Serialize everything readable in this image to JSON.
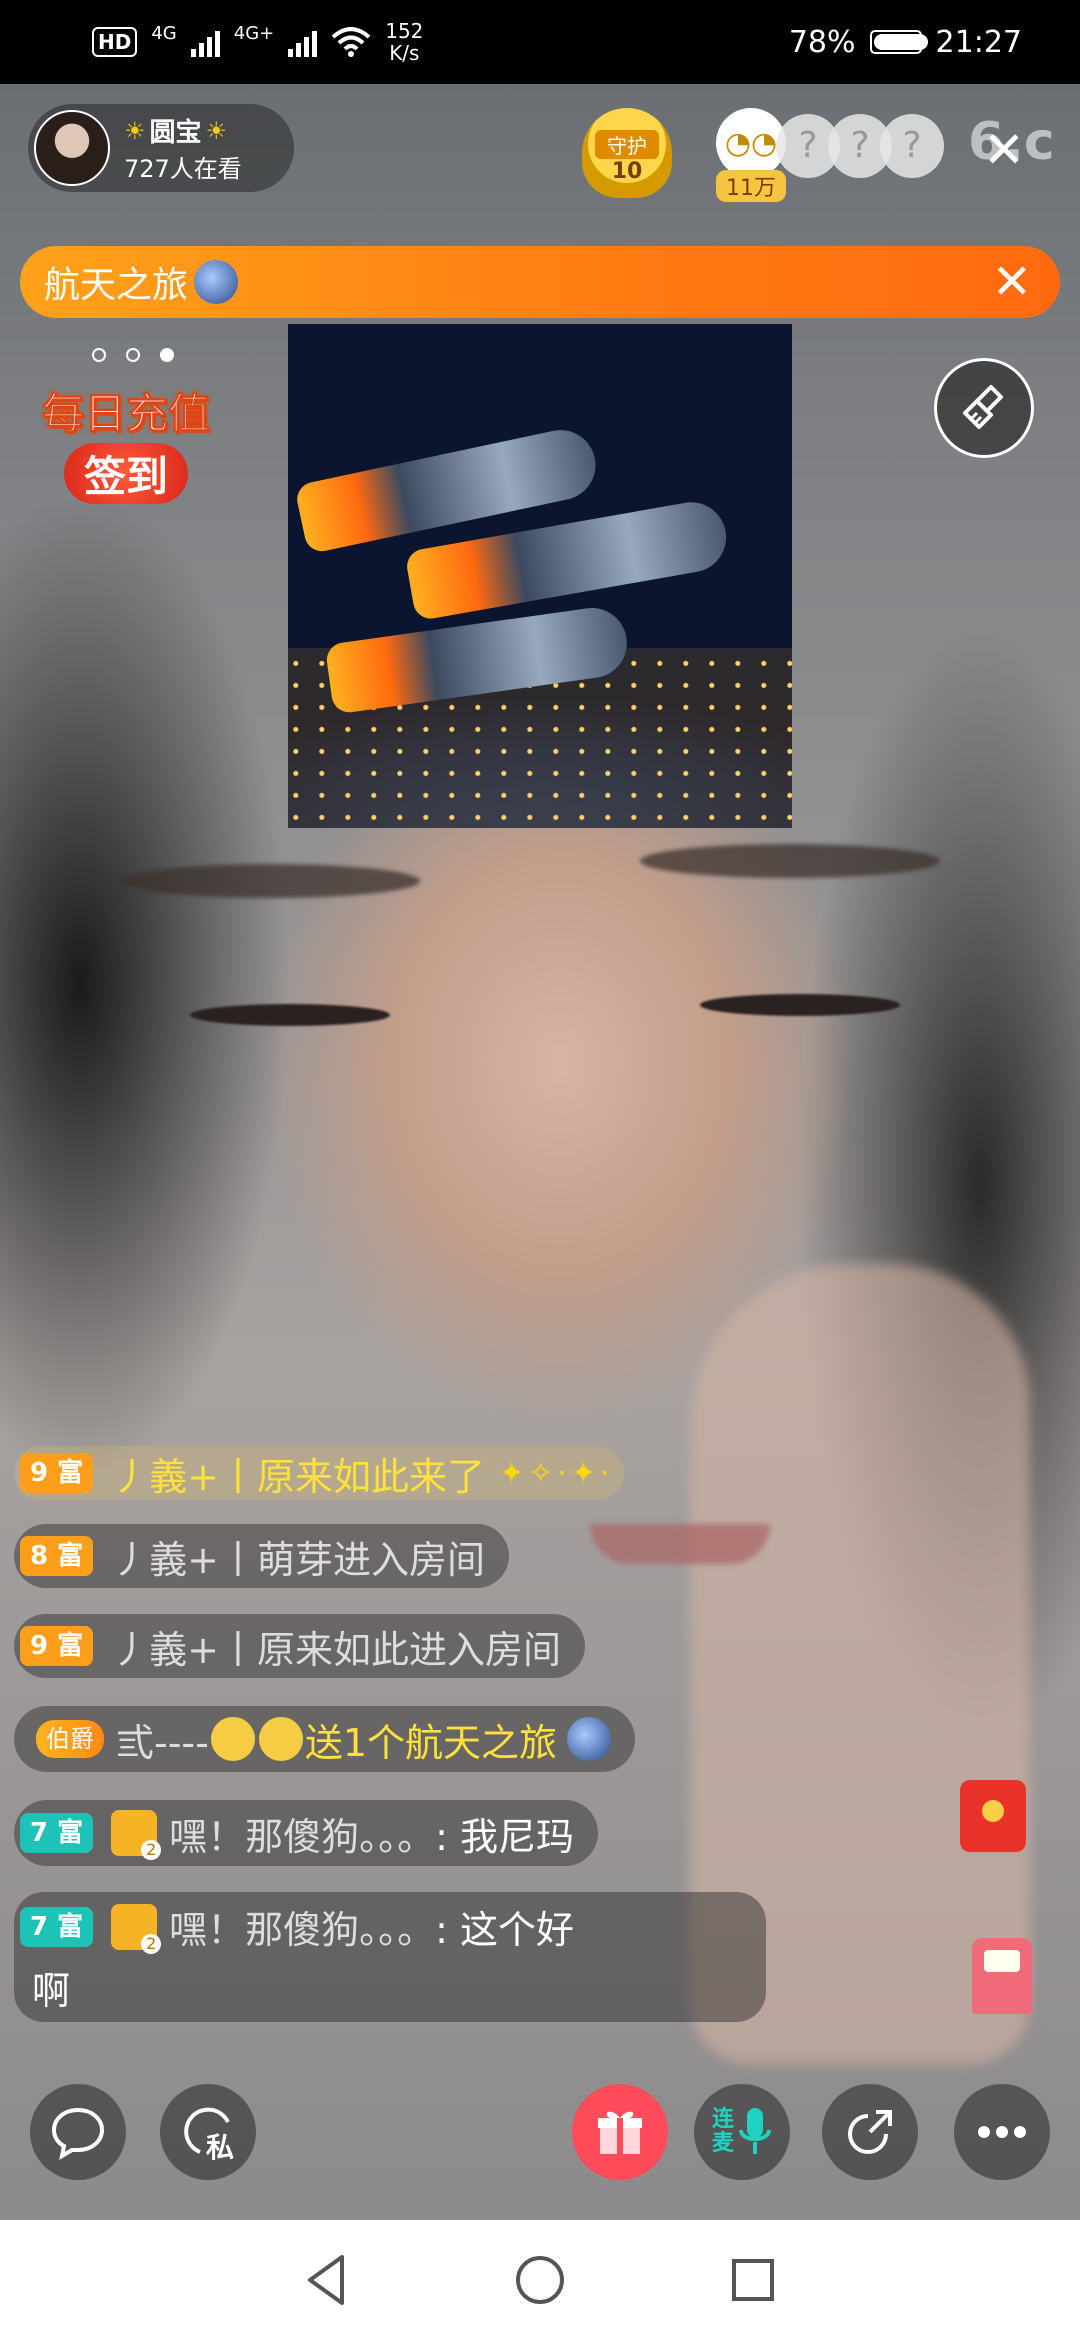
{
  "status_bar": {
    "hd": "HD",
    "sig1": "4G",
    "sig2": "4G+",
    "speed_value": "152",
    "speed_unit": "K/s",
    "battery": "78%",
    "battery_level": 0.78,
    "time": "21:27"
  },
  "host": {
    "name": "圆宝",
    "viewers": "727人在看"
  },
  "guard": {
    "label": "守护",
    "count": "10"
  },
  "top_fan": {
    "score": "11万"
  },
  "banner": {
    "text": "航天之旅"
  },
  "daily_badge": {
    "line1": "每日充值",
    "line2": "签到"
  },
  "chat": {
    "messages": [
      {
        "level": "9 富",
        "user": "丿義+丨原来如此",
        "action": " 来了"
      },
      {
        "level": "8 富",
        "user": "丿義+丨萌芽",
        "action": " 进入房间"
      },
      {
        "level": "9 富",
        "user": "丿義+丨原来如此",
        "action": " 进入房间"
      },
      {
        "medal": "伯爵",
        "user": "弎----",
        "action": " 送1个航天之旅"
      },
      {
        "level": "7 富",
        "user": "嘿！那傻狗。。。",
        "text": ": 我尼玛"
      },
      {
        "level": "7 富",
        "user": "嘿！那傻狗。。。",
        "text": ": 这个好",
        "text2": "啊"
      }
    ]
  },
  "controls": {
    "private_label": "私",
    "mic_label_1": "连",
    "mic_label_2": "麦"
  },
  "colors": {
    "banner_orange": "#ff7a12",
    "level_orange": "#ff9e1a",
    "level_teal": "#1ec3b8",
    "gift_red": "#ff4b5a",
    "highlight_yellow": "#ffe13a"
  }
}
